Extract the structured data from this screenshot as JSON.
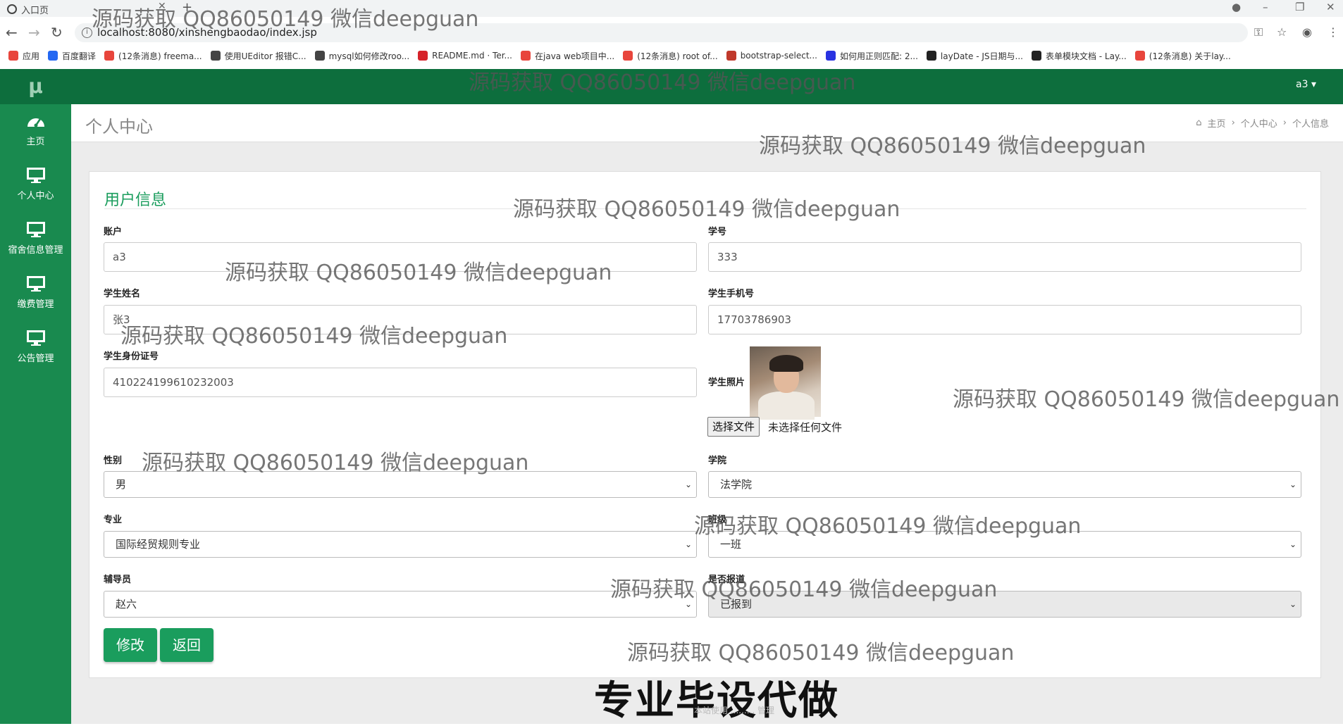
{
  "browser": {
    "tab_title": "入口页",
    "url": "localhost:8080/xinshengbaodao/index.jsp",
    "bookmarks": [
      {
        "label": "应用",
        "color": "#e8453c"
      },
      {
        "label": "百度翻译",
        "color": "#2468f2"
      },
      {
        "label": "(12条消息) freema...",
        "color": "#e8453c"
      },
      {
        "label": "使用UEditor 报错C...",
        "color": "#444444"
      },
      {
        "label": "mysql如何修改roo...",
        "color": "#444444"
      },
      {
        "label": "README.md · Ter...",
        "color": "#d6232a"
      },
      {
        "label": "在java web项目中...",
        "color": "#e8453c"
      },
      {
        "label": "(12条消息) root of...",
        "color": "#e8453c"
      },
      {
        "label": "bootstrap-select...",
        "color": "#c0392b"
      },
      {
        "label": "如何用正则匹配: 2...",
        "color": "#2932e1"
      },
      {
        "label": "layDate - JS日期与...",
        "color": "#222222"
      },
      {
        "label": "表单模块文档 - Lay...",
        "color": "#222222"
      },
      {
        "label": "(12条消息) 关于lay...",
        "color": "#e8453c"
      }
    ]
  },
  "sidebar": {
    "logo": "μ",
    "items": [
      {
        "label": "主页",
        "icon": "dashboard-icon"
      },
      {
        "label": "个人中心",
        "icon": "monitor-icon"
      },
      {
        "label": "宿舍信息管理",
        "icon": "monitor-icon"
      },
      {
        "label": "缴费管理",
        "icon": "monitor-icon"
      },
      {
        "label": "公告管理",
        "icon": "monitor-icon"
      }
    ]
  },
  "topbar": {
    "user": "a3 ▾"
  },
  "header": {
    "title": "个人中心",
    "breadcrumb": [
      "主页",
      "个人中心",
      "个人信息"
    ]
  },
  "form": {
    "title": "用户信息",
    "account_label": "账户",
    "account_value": "a3",
    "student_no_label": "学号",
    "student_no_value": "333",
    "name_label": "学生姓名",
    "name_value": "张3",
    "phone_label": "学生手机号",
    "phone_value": "17703786903",
    "idcard_label": "学生身份证号",
    "idcard_value": "410224199610232003",
    "photo_label": "学生照片",
    "file_button": "选择文件",
    "file_status": "未选择任何文件",
    "gender_label": "性别",
    "gender_value": "男",
    "college_label": "学院",
    "college_value": "法学院",
    "major_label": "专业",
    "major_value": "国际经贸规则专业",
    "class_label": "班级",
    "class_value": "一班",
    "counselor_label": "辅导员",
    "counselor_value": "赵六",
    "reported_label": "是否报道",
    "reported_value": "已报到",
    "edit_button": "修改",
    "back_button": "返回"
  },
  "watermark": {
    "text": "源码获取 QQ86050149 微信deepguan",
    "banner": "专业毕设代做",
    "banner_sub": "本站使用 ......... 管理"
  },
  "colors": {
    "sidebar": "#198a4f",
    "topbar": "#0d6e3d",
    "accent": "#1a9d5d"
  }
}
